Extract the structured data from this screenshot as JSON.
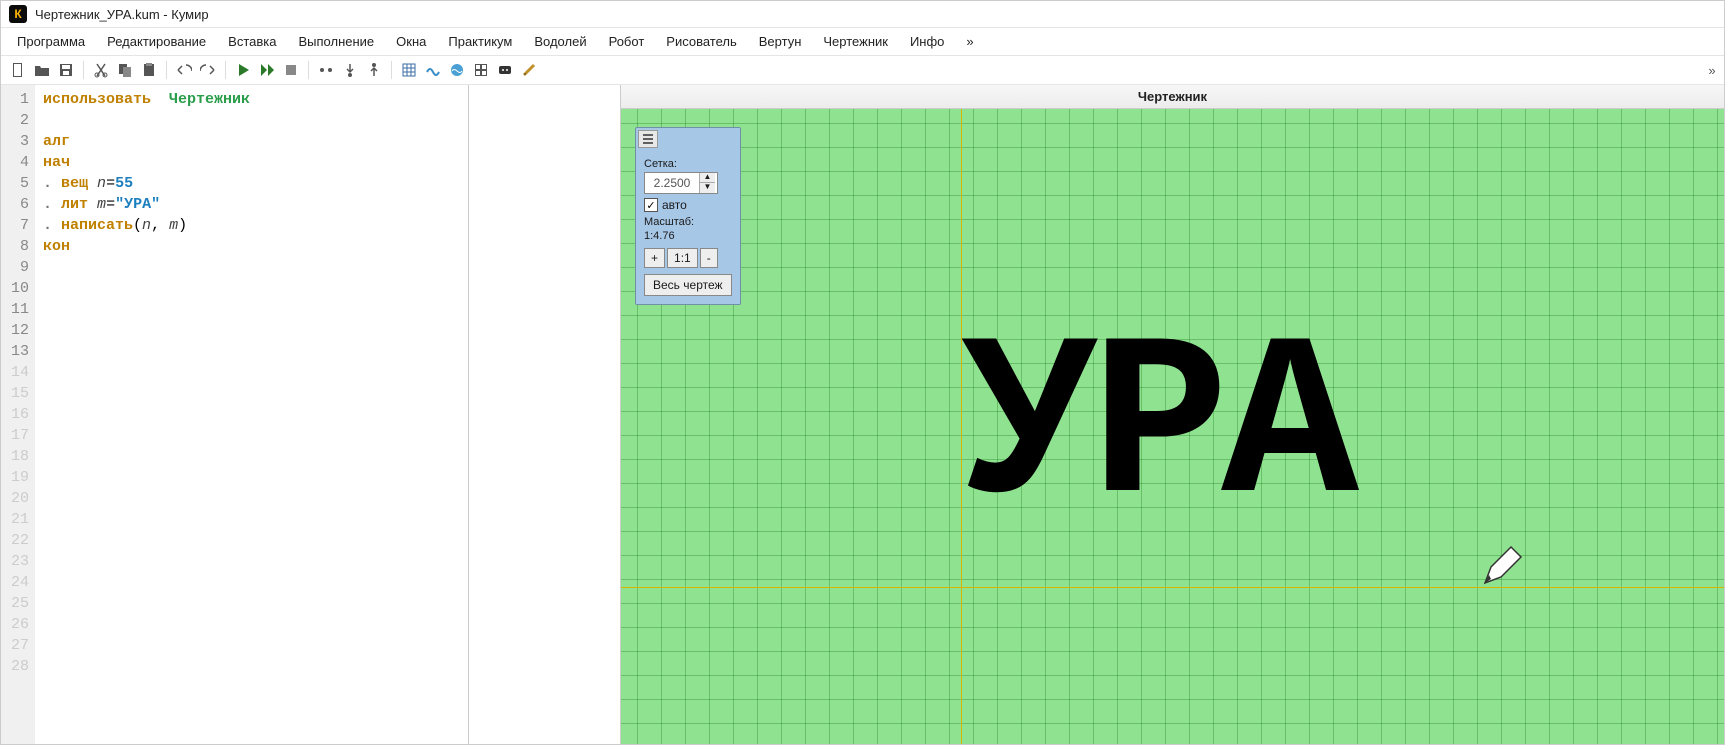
{
  "title": "Чертежник_УРА.kum - Кумир",
  "app_icon_letter": "К",
  "menu": [
    "Программа",
    "Редактирование",
    "Вставка",
    "Выполнение",
    "Окна",
    "Практикум",
    "Водолей",
    "Робот",
    "Рисователь",
    "Вертун",
    "Чертежник",
    "Инфо",
    "»"
  ],
  "toolbar_overflow": "»",
  "editor": {
    "line_count": 28,
    "active_lines": 13,
    "lines": [
      {
        "t": "use",
        "indent": 0,
        "kw": "использовать",
        "mod": "Чертежник"
      },
      {
        "t": "blank"
      },
      {
        "t": "kw",
        "indent": 0,
        "kw": "алг"
      },
      {
        "t": "kw",
        "indent": 0,
        "kw": "нач"
      },
      {
        "t": "decl",
        "indent": 1,
        "kw": "вещ",
        "var": "n",
        "op": "=",
        "val": "55",
        "val_type": "num"
      },
      {
        "t": "decl",
        "indent": 1,
        "kw": "лит",
        "var": "m",
        "op": "=",
        "val": "\"УРА\"",
        "val_type": "str"
      },
      {
        "t": "call",
        "indent": 1,
        "kw": "написать",
        "args": [
          "n",
          "m"
        ]
      },
      {
        "t": "kw",
        "indent": 0,
        "kw": "кон"
      }
    ]
  },
  "right": {
    "title": "Чертежник",
    "panel": {
      "grid_label": "Сетка:",
      "grid_value": "2.2500",
      "auto_checked": true,
      "auto_label": "авто",
      "scale_label": "Масштаб:",
      "scale_value": "1:4.76",
      "zoom_in": "+",
      "zoom_reset": "1:1",
      "zoom_out": "-",
      "fit": "Весь чертеж"
    },
    "drawn_text": "УРА"
  }
}
